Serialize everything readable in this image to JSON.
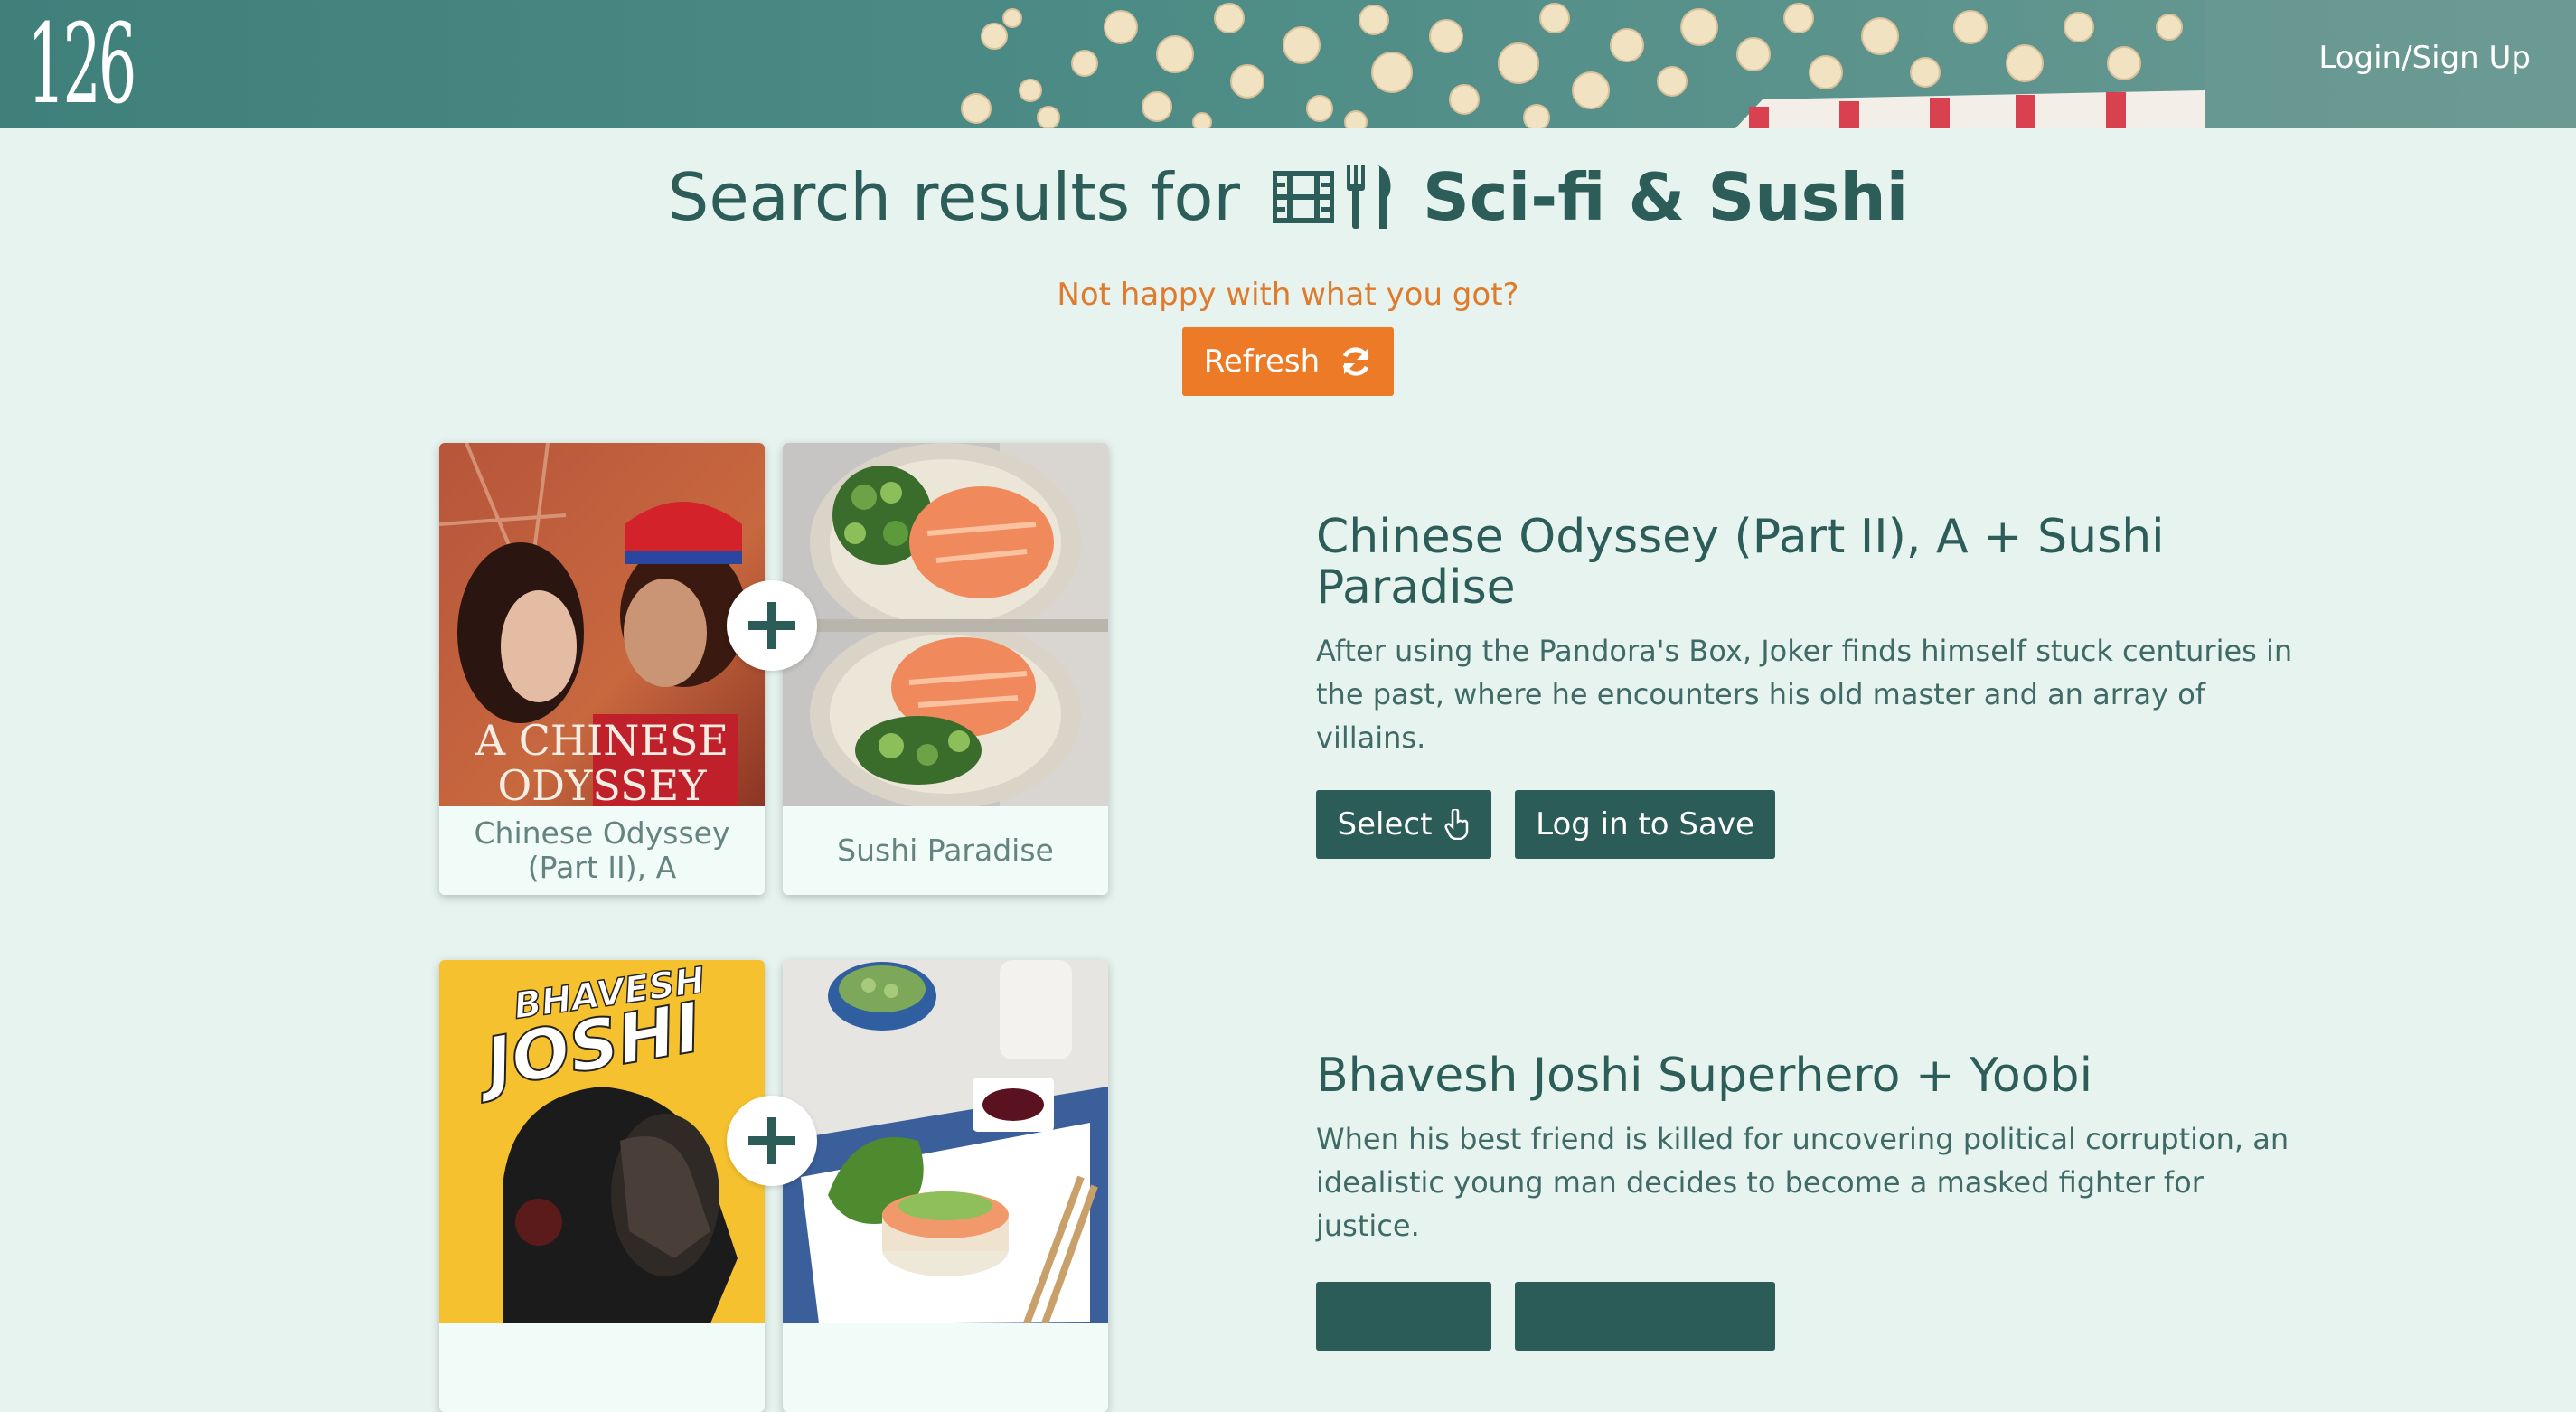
{
  "header": {
    "logo": "126",
    "login": "Login/Sign Up"
  },
  "search": {
    "title_prefix": "Search results for",
    "term": "Sci-fi & Sushi",
    "icons": [
      "film-icon",
      "utensils-icon"
    ]
  },
  "refresh": {
    "prompt": "Not happy with what you got?",
    "button_label": "Refresh",
    "icon": "refresh-icon"
  },
  "results": [
    {
      "title": "Chinese Odyssey (Part II), A + Sushi Paradise",
      "description": "After using the Pandora's Box, Joker finds himself stuck centuries in the past, where he encounters his old master and an array of villains.",
      "movie": {
        "caption": "Chinese Odyssey (Part II), A",
        "poster_text_line1": "A CHINESE",
        "poster_text_line2": "ODYSSEY"
      },
      "food": {
        "caption": "Sushi Paradise"
      },
      "select_label": "Select",
      "save_label": "Log in to Save"
    },
    {
      "title": "Bhavesh Joshi Superhero + Yoobi",
      "description": "When his best friend is killed for uncovering political corruption, an idealistic young man decides to become a masked fighter for justice.",
      "movie": {
        "poster_text_line1": "BHAVESH",
        "poster_text_line2": "JOSHI"
      }
    }
  ],
  "colors": {
    "header": "#4b8782",
    "page_bg": "#e6f3ee",
    "primary": "#2b5c57",
    "accent": "#ec7a26"
  }
}
